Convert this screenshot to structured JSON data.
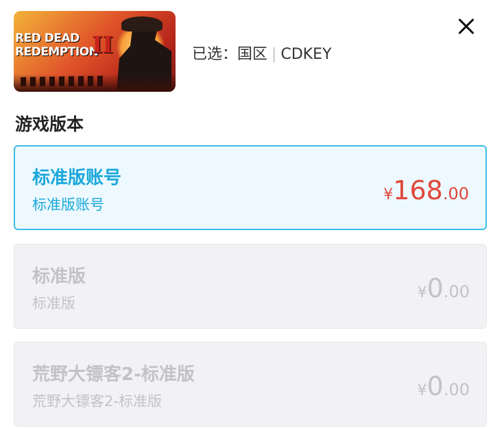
{
  "product": {
    "cover_logo_line1": "RED DEAD",
    "cover_logo_line2": "REDEMPTION",
    "cover_logo_numeral": "II"
  },
  "selection": {
    "prefix": "已选：",
    "region": "国区",
    "separator": "|",
    "type": "CDKEY"
  },
  "section_title": "游戏版本",
  "options": [
    {
      "name": "标准版账号",
      "sub": "标准版账号",
      "currency": "¥",
      "price_int": "168",
      "price_dec": ".00",
      "state": "selected"
    },
    {
      "name": "标准版",
      "sub": "标准版",
      "currency": "¥",
      "price_int": "0",
      "price_dec": ".00",
      "state": "disabled"
    },
    {
      "name": "荒野大镖客2-标准版",
      "sub": "荒野大镖客2-标准版",
      "currency": "¥",
      "price_int": "0",
      "price_dec": ".00",
      "state": "disabled"
    }
  ],
  "icons": {
    "close": "close-icon"
  },
  "colors": {
    "accent": "#1aa7da",
    "accent_border": "#3bbde6",
    "selected_bg": "#edf9fe",
    "price_red": "#e0463a",
    "disabled_text": "#c3c3c6",
    "disabled_bg": "#f2f2f4"
  }
}
